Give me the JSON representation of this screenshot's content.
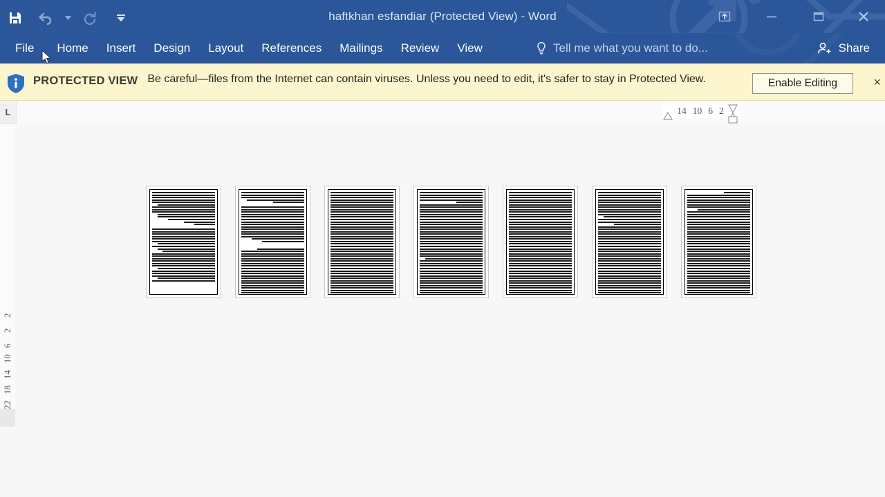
{
  "window": {
    "title": "haftkhan esfandiar (Protected View) - Word",
    "quick_access": [
      {
        "name": "save-button",
        "icon": "save-icon",
        "label": "Save"
      },
      {
        "name": "undo-button",
        "icon": "undo-icon",
        "label": "Undo"
      },
      {
        "name": "undo-dropdown",
        "icon": "chevron-down-icon",
        "label": "Undo options"
      },
      {
        "name": "redo-button",
        "icon": "redo-icon",
        "label": "Redo"
      },
      {
        "name": "customize-qat-button",
        "icon": "chevron-down-icon",
        "label": "Customize Quick Access Toolbar"
      }
    ],
    "controls": [
      {
        "name": "ribbon-display-options-button",
        "icon": "ribbon-display-icon",
        "label": "Ribbon Display Options"
      },
      {
        "name": "minimize-button",
        "icon": "minimize-icon",
        "label": "Minimize"
      },
      {
        "name": "restore-button",
        "icon": "restore-icon",
        "label": "Restore Down"
      },
      {
        "name": "close-button",
        "icon": "close-icon",
        "label": "Close"
      }
    ]
  },
  "ribbon": {
    "tabs": [
      {
        "label": "File"
      },
      {
        "label": "Home"
      },
      {
        "label": "Insert"
      },
      {
        "label": "Design"
      },
      {
        "label": "Layout"
      },
      {
        "label": "References"
      },
      {
        "label": "Mailings"
      },
      {
        "label": "Review"
      },
      {
        "label": "View"
      }
    ],
    "tell_me_placeholder": "Tell me what you want to do...",
    "share_label": "Share"
  },
  "protected_view": {
    "badge": "PROTECTED VIEW",
    "message": "Be careful—files from the Internet can contain viruses. Unless you need to edit, it's safer to stay in Protected View.",
    "enable_button": "Enable Editing",
    "close_label": "×"
  },
  "rulers": {
    "tab_selector": "L",
    "horizontal_ticks": [
      "14",
      "10",
      "6",
      "2"
    ],
    "vertical_ticks": [
      "2",
      "2",
      "6",
      "10",
      "14",
      "18",
      "22"
    ]
  },
  "document": {
    "page_count": 7,
    "pages": [
      {
        "number": 1,
        "lines": [
          12,
          12,
          12,
          12,
          12,
          11,
          12,
          12,
          12,
          11,
          11,
          9,
          6,
          4,
          0,
          12,
          12,
          12,
          12,
          12,
          12,
          11,
          12,
          11,
          10,
          12,
          12,
          12,
          12,
          12,
          12,
          11,
          12,
          12,
          12,
          11,
          12,
          0,
          0,
          0,
          0,
          0,
          0,
          0,
          0,
          0,
          0
        ]
      },
      {
        "number": 2,
        "lines": [
          12,
          12,
          12,
          11,
          6,
          0,
          12,
          12,
          12,
          12,
          12,
          12,
          12,
          12,
          12,
          12,
          12,
          12,
          12,
          10,
          8,
          0,
          0,
          9,
          12,
          12,
          12,
          12,
          12,
          12,
          12,
          12,
          12,
          12,
          12,
          12,
          12,
          12,
          12,
          12,
          12,
          12,
          12,
          12,
          12,
          11,
          9
        ]
      },
      {
        "number": 3,
        "lines": [
          12,
          12,
          12,
          12,
          12,
          12,
          12,
          12,
          12,
          12,
          12,
          12,
          12,
          12,
          12,
          12,
          12,
          12,
          12,
          12,
          12,
          12,
          12,
          12,
          12,
          12,
          12,
          12,
          12,
          12,
          12,
          12,
          12,
          12,
          12,
          12,
          12,
          12,
          12,
          12,
          12,
          12,
          12,
          12,
          12,
          12,
          11
        ]
      },
      {
        "number": 4,
        "lines": [
          12,
          12,
          12,
          12,
          5,
          12,
          12,
          12,
          12,
          12,
          12,
          12,
          12,
          12,
          12,
          12,
          12,
          12,
          12,
          12,
          12,
          12,
          12,
          12,
          12,
          12,
          12,
          11,
          12,
          12,
          12,
          12,
          12,
          12,
          12,
          12,
          12,
          12,
          12,
          12,
          12,
          12,
          12,
          12,
          12,
          12,
          11
        ]
      },
      {
        "number": 5,
        "lines": [
          12,
          12,
          12,
          12,
          12,
          12,
          12,
          12,
          12,
          12,
          12,
          12,
          12,
          12,
          12,
          12,
          12,
          12,
          12,
          12,
          12,
          12,
          12,
          12,
          12,
          12,
          12,
          12,
          12,
          12,
          12,
          12,
          12,
          12,
          12,
          12,
          12,
          12,
          12,
          12,
          12,
          12,
          12,
          12,
          12,
          12,
          12
        ]
      },
      {
        "number": 6,
        "lines": [
          12,
          12,
          12,
          12,
          12,
          12,
          12,
          12,
          12,
          12,
          11,
          12,
          12,
          9,
          12,
          12,
          12,
          12,
          12,
          12,
          12,
          12,
          12,
          12,
          12,
          12,
          12,
          12,
          12,
          12,
          12,
          12,
          12,
          12,
          12,
          12,
          12,
          12,
          12,
          12,
          12,
          12,
          12,
          12,
          12,
          8,
          8
        ]
      },
      {
        "number": 7,
        "lines": [
          5,
          12,
          12,
          12,
          12,
          12,
          12,
          10,
          12,
          12,
          12,
          12,
          12,
          12,
          12,
          12,
          12,
          12,
          12,
          12,
          12,
          12,
          12,
          12,
          12,
          12,
          12,
          12,
          12,
          12,
          12,
          12,
          12,
          12,
          12,
          12,
          12,
          12,
          12,
          12,
          12,
          12,
          12,
          12,
          12,
          12,
          12
        ]
      }
    ]
  },
  "colors": {
    "titlebar": "#2b579a",
    "protected_view_bg": "#fcf5ce",
    "canvas": "#f7f7f7",
    "page": "#ffffff"
  }
}
